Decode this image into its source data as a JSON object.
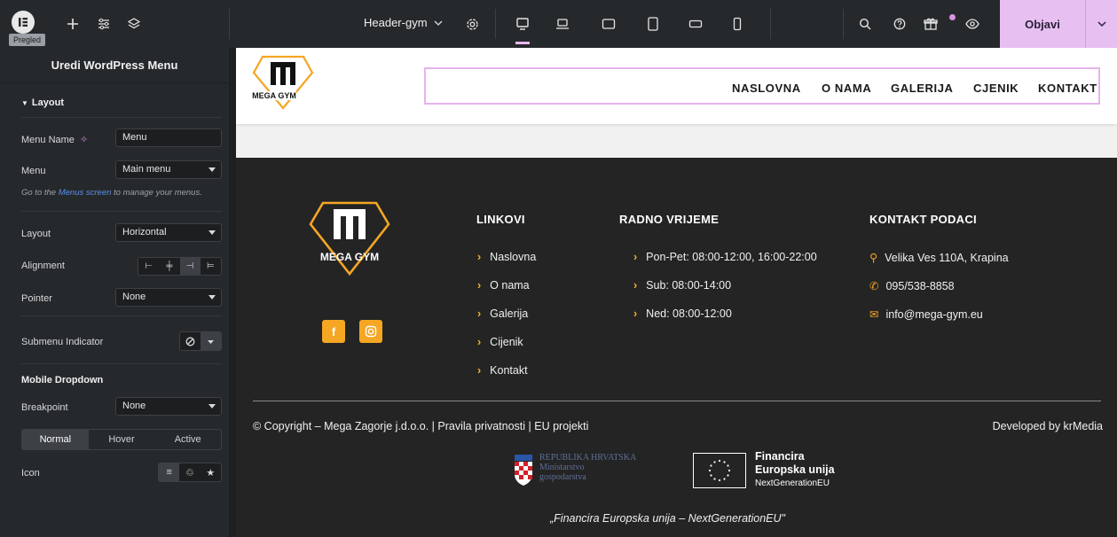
{
  "topbar": {
    "tooltip": "Pregled",
    "doc_title": "Header-gym",
    "publish_label": "Objavi",
    "icons": [
      "elementor-logo-icon",
      "plus-icon",
      "sliders-icon",
      "layers-icon",
      "chevron-down-icon",
      "gear-icon",
      "desktop-icon",
      "laptop-icon",
      "tablet-landscape-icon",
      "tablet-portrait-icon",
      "mobile-landscape-icon",
      "mobile-portrait-icon",
      "search-icon",
      "help-icon",
      "gift-icon",
      "eye-icon"
    ]
  },
  "panel": {
    "title": "Uredi WordPress Menu",
    "layout_section": "Layout",
    "menu_name_label": "Menu Name",
    "menu_name_value": "Menu",
    "menu_label": "Menu",
    "menu_value": "Main menu",
    "note_prefix": "Go to the ",
    "note_link": "Menus screen",
    "note_suffix": " to manage your menus.",
    "layout_label": "Layout",
    "layout_value": "Horizontal",
    "alignment_label": "Alignment",
    "pointer_label": "Pointer",
    "pointer_value": "None",
    "submenu_label": "Submenu Indicator",
    "mobile_dropdown": "Mobile Dropdown",
    "breakpoint_label": "Breakpoint",
    "breakpoint_value": "None",
    "tabs": [
      "Normal",
      "Hover",
      "Active"
    ],
    "icon_label": "Icon"
  },
  "header": {
    "logo_text": "MEGA GYM",
    "nav": [
      "NASLOVNA",
      "O NAMA",
      "GALERIJA",
      "CJENIK",
      "KONTAKT"
    ]
  },
  "footer": {
    "logo_text": "MEGA GYM",
    "links_title": "LINKOVI",
    "links": [
      "Naslovna",
      "O nama",
      "Galerija",
      "Cijenik",
      "Kontakt"
    ],
    "hours_title": "RADNO VRIJEME",
    "hours": [
      "Pon-Pet: 08:00-12:00, 16:00-22:00",
      "Sub: 08:00-14:00",
      "Ned: 08:00-12:00"
    ],
    "contact_title": "KONTAKT PODACI",
    "contact": [
      "Velika Ves 110A, Krapina",
      "095/538-8858",
      "info@mega-gym.eu"
    ],
    "copyright": "© Copyright – Mega Zagorje j.d.o.o. | Pravila privatnosti | EU projekti",
    "developed": "Developed by krMedia",
    "ministry_lines": [
      "REPUBLIKA HRVATSKA",
      "Ministarstvo",
      "gospodarstva"
    ],
    "eu_lines": [
      "Financira",
      "Europska unija",
      "NextGenerationEU"
    ],
    "quote": "„Financira Europska unija – NextGenerationEU\""
  },
  "colors": {
    "accent": "#f5a623",
    "publish": "#e7bff0",
    "footer_bg": "#242424"
  }
}
